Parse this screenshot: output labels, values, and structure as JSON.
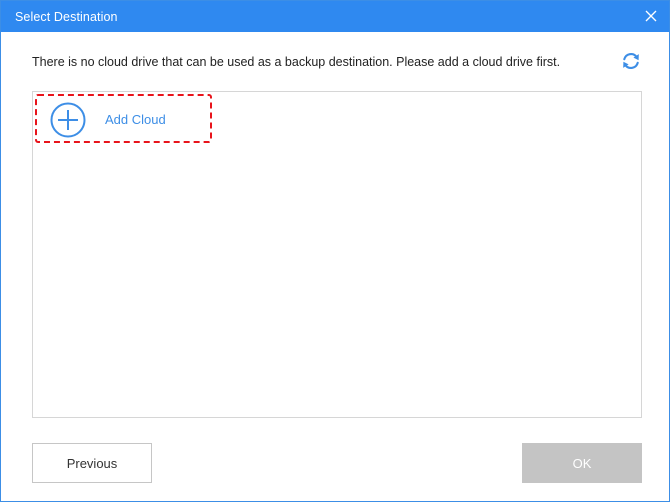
{
  "window": {
    "title": "Select Destination"
  },
  "message": "There is no cloud drive that can be used as a backup destination. Please add a cloud drive first.",
  "list": {
    "add_cloud_label": "Add Cloud"
  },
  "footer": {
    "previous_label": "Previous",
    "ok_label": "OK",
    "ok_enabled": false
  },
  "icons": {
    "close": "close-icon",
    "refresh": "refresh-icon",
    "add": "plus-circle-icon"
  },
  "colors": {
    "title_bar": "#2f89f0",
    "accent": "#3d8ee6",
    "highlight_border": "#e8141b",
    "disabled_button": "#c4c4c4"
  }
}
